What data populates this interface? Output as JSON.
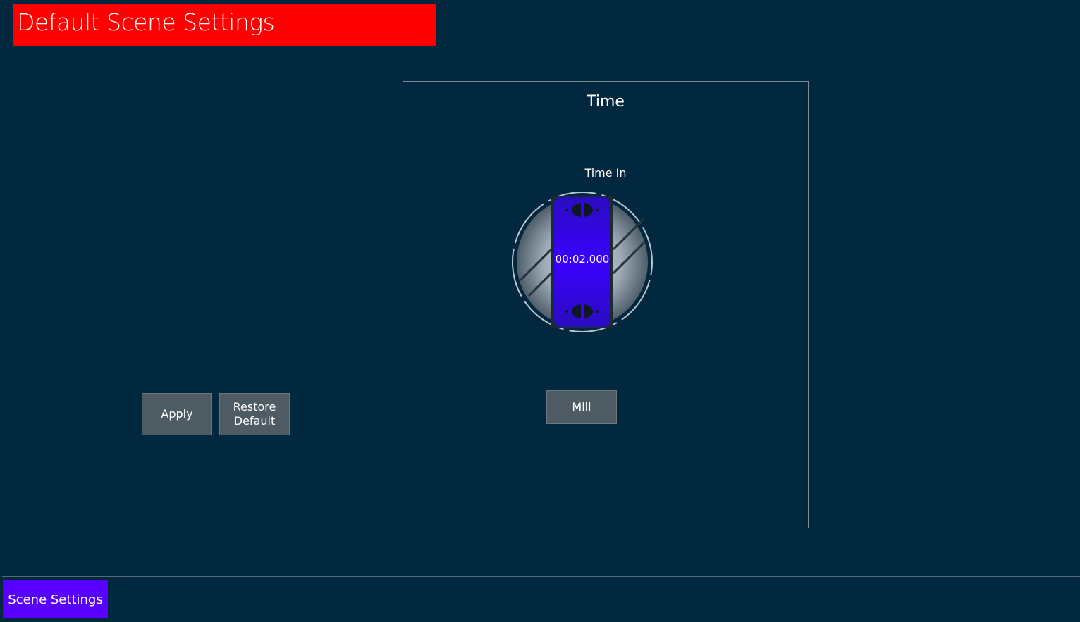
{
  "header": {
    "title": "Default Scene Settings"
  },
  "actions": {
    "apply_label": "Apply",
    "restore_label": "Restore\nDefault"
  },
  "time_panel": {
    "title": "Time",
    "time_in": {
      "label": "Time In",
      "value": "00:02.000"
    },
    "unit_button_label": "Mili"
  },
  "footer": {
    "tabs": [
      {
        "label": "Scene Settings",
        "active": true
      }
    ]
  },
  "colors": {
    "background": "#022840",
    "title_bar": "#ff0000",
    "button": "#4e5b63",
    "dial_accent": "#3a00ff",
    "active_tab": "#5800ff"
  },
  "icons": {
    "dial_up": "chevron-up-icon",
    "dial_down": "chevron-down-icon"
  }
}
